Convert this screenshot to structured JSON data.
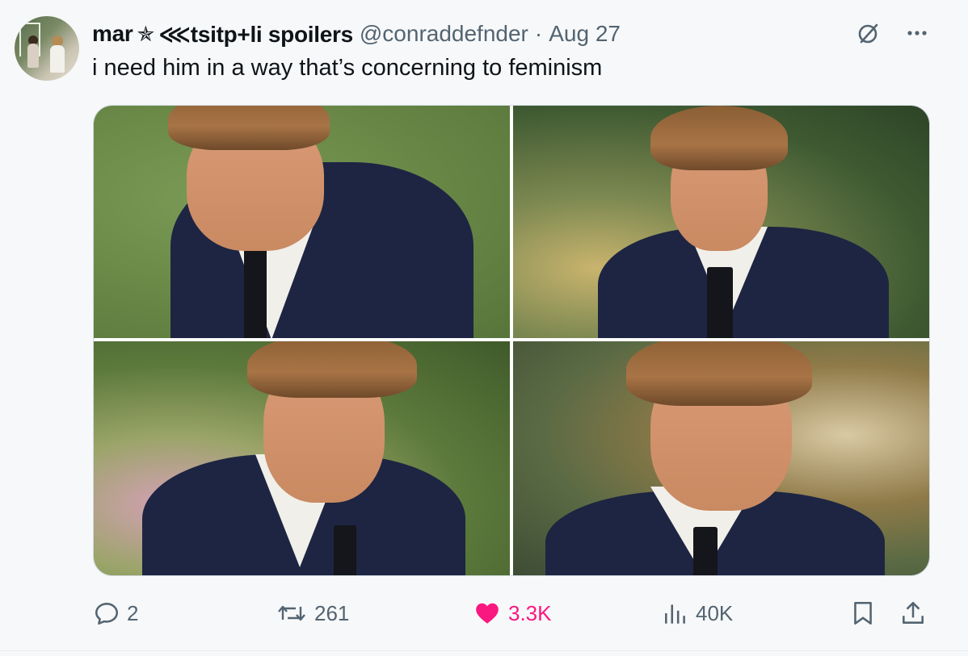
{
  "tweet": {
    "author": {
      "name_part1": "mar",
      "name_symbol": "✯",
      "name_part2": "⋘tsitp+li spoilers",
      "handle": "@conraddefnder",
      "separator": "·",
      "date": "Aug 27"
    },
    "text": "i need him in a way that’s concerning to feminism",
    "media_count": 4,
    "stats": {
      "replies": "2",
      "reposts": "261",
      "likes": "3.3K",
      "views": "40K"
    },
    "liked": true
  },
  "colors": {
    "text_primary": "#0f1419",
    "text_secondary": "#536471",
    "like_active": "#f91880",
    "background": "#f7f8f9"
  },
  "icons": {
    "top": [
      "grok-icon",
      "more-icon"
    ],
    "actions": [
      "reply-icon",
      "repost-icon",
      "heart-icon",
      "views-icon",
      "bookmark-icon",
      "share-icon"
    ]
  }
}
